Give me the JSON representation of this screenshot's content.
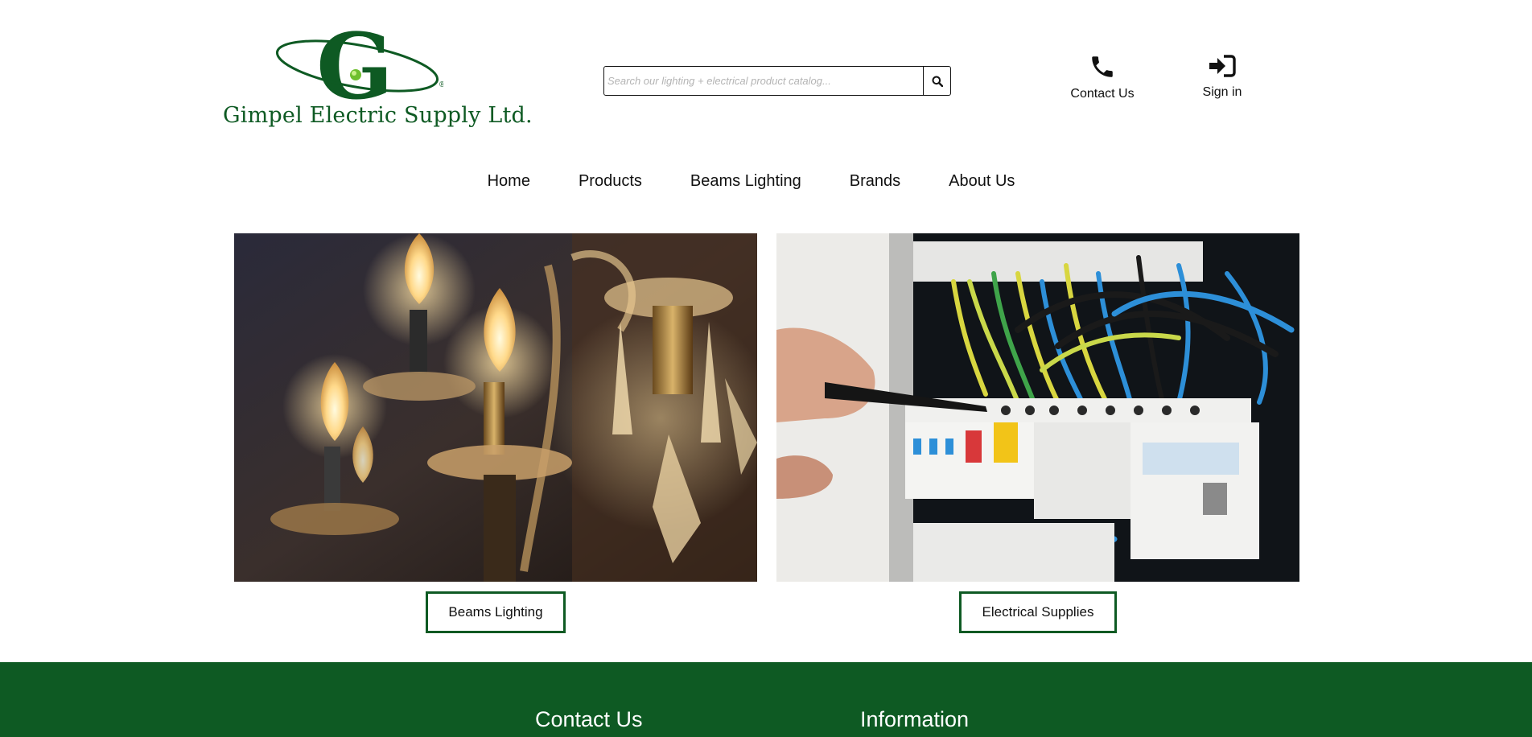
{
  "brand": {
    "name": "Gimpel Electric Supply Ltd.",
    "letter": "G",
    "mark": "®",
    "color": "#0e5a23",
    "accent": "#6fbf2f"
  },
  "search": {
    "placeholder": "Search our lighting + electrical product catalog...",
    "icon": "search-icon"
  },
  "header_actions": [
    {
      "label": "Contact Us",
      "icon": "phone-icon"
    },
    {
      "label": "Sign in",
      "icon": "sign-in-icon"
    }
  ],
  "nav": {
    "items": [
      "Home",
      "Products",
      "Beams Lighting",
      "Brands",
      "About Us"
    ]
  },
  "hero": {
    "left": {
      "button_label": "Beams Lighting",
      "image": "chandelier-photo"
    },
    "right": {
      "button_label": "Electrical Supplies",
      "image": "electrical-panel-photo"
    }
  },
  "footer": {
    "bg_color": "#0e5a23",
    "headings": [
      "Contact Us",
      "Information"
    ]
  }
}
